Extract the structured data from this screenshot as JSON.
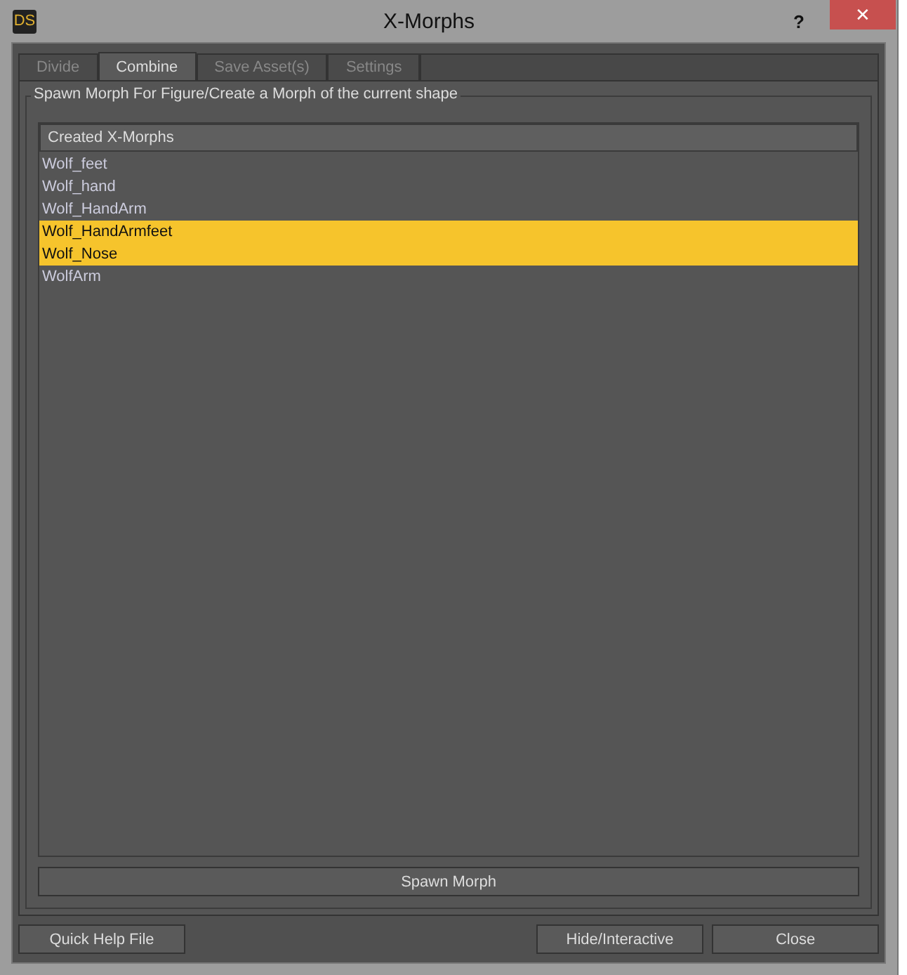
{
  "window": {
    "title": "X-Morphs",
    "logo": "DS",
    "help": "?",
    "close": "✕"
  },
  "tabs": [
    {
      "label": "Divide",
      "selected": false
    },
    {
      "label": "Combine",
      "selected": true
    },
    {
      "label": "Save Asset(s)",
      "selected": false
    },
    {
      "label": "Settings",
      "selected": false
    }
  ],
  "group": {
    "title": "Spawn Morph For Figure/Create a Morph of the current shape"
  },
  "list": {
    "header": "Created X-Morphs",
    "items": [
      {
        "label": "Wolf_feet",
        "selected": false
      },
      {
        "label": "Wolf_hand",
        "selected": false
      },
      {
        "label": "Wolf_HandArm",
        "selected": false
      },
      {
        "label": "Wolf_HandArmfeet",
        "selected": true
      },
      {
        "label": "Wolf_Nose",
        "selected": true
      },
      {
        "label": "WolfArm",
        "selected": false
      }
    ]
  },
  "spawn_button": "Spawn Morph",
  "footer": {
    "left": [
      "Quick Help File"
    ],
    "right": [
      "Hide/Interactive",
      "Close"
    ]
  }
}
